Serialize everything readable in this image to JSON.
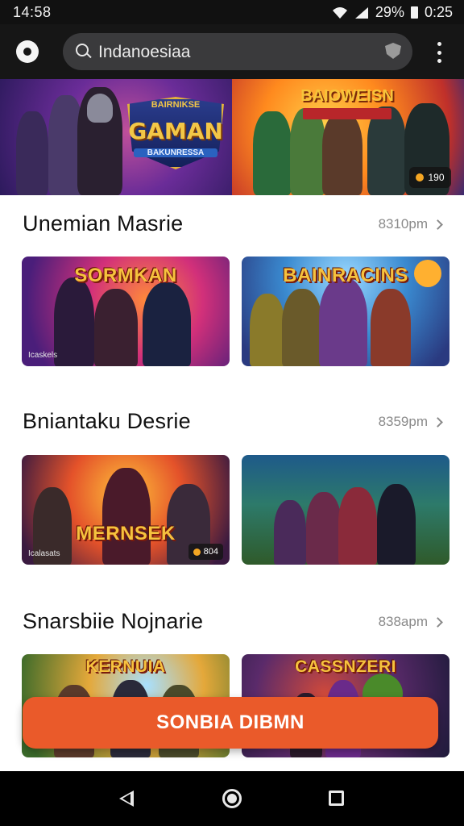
{
  "status_bar": {
    "time": "14:58",
    "battery_text": "29%",
    "clock_right": "0:25"
  },
  "toolbar": {
    "search_value": "Indanoesiaa",
    "logo_icon": "app-logo-icon",
    "menu_icon": "more-vertical-icon",
    "shield_icon": "shield-icon"
  },
  "hero": {
    "left_logo_top": "BAIRNIKSE",
    "left_logo_text": "GAMAN",
    "left_logo_sub": "BAKUNRESSA",
    "right_title": "BAIOWEISN",
    "badge_value": "190"
  },
  "sections": [
    {
      "title": "Unemian Masrie",
      "more": "8310pm",
      "cards": [
        {
          "title": "SORMKAN",
          "label": "Icaskels",
          "badge": ""
        },
        {
          "title": "BAINRACINS",
          "label": "",
          "badge": ""
        }
      ]
    },
    {
      "title": "Bniantaku Desrie",
      "more": "8359pm",
      "cards": [
        {
          "title": "MERNSEK",
          "label": "Icalasats",
          "badge": "804"
        },
        {
          "title": "",
          "label": "",
          "badge": ""
        }
      ]
    },
    {
      "title": "Snarsbiie Nojnarie",
      "more": "838apm",
      "cards": [
        {
          "title": "KERNUIA",
          "label": "",
          "badge": ""
        },
        {
          "title": "CASSNZERI",
          "label": "",
          "badge": ""
        }
      ]
    }
  ],
  "cta": {
    "label": "SONBIA DIBMN"
  },
  "colors": {
    "accent": "#ea5a2a",
    "toolbar_bg": "#161616",
    "search_bg": "#3a3a3c"
  }
}
